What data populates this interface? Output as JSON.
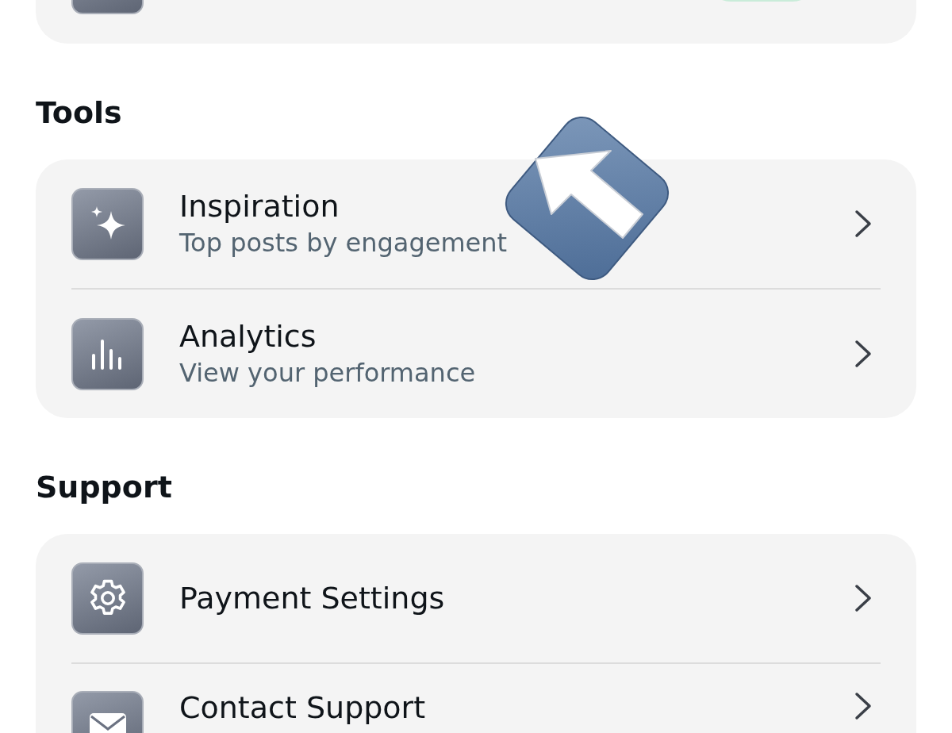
{
  "sections": [
    {
      "heading": "Tools",
      "items": [
        {
          "title": "Inspiration",
          "subtitle": "Top posts by engagement"
        },
        {
          "title": "Analytics",
          "subtitle": "View your performance"
        }
      ]
    },
    {
      "heading": "Support",
      "items": [
        {
          "title": "Payment Settings"
        },
        {
          "title": "Contact Support"
        }
      ]
    }
  ]
}
